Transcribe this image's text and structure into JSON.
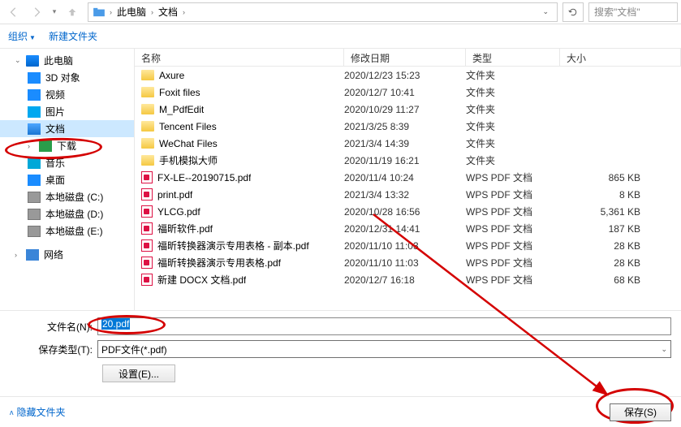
{
  "breadcrumb": {
    "root": "此电脑",
    "folder": "文档"
  },
  "search_placeholder": "搜索\"文档\"",
  "subtoolbar": {
    "organize": "组织",
    "newfolder": "新建文件夹"
  },
  "sidebar": {
    "this_pc": "此电脑",
    "items": [
      {
        "label": "3D 对象"
      },
      {
        "label": "视频"
      },
      {
        "label": "图片"
      },
      {
        "label": "文档"
      },
      {
        "label": "下载"
      },
      {
        "label": "音乐"
      },
      {
        "label": "桌面"
      },
      {
        "label": "本地磁盘 (C:)"
      },
      {
        "label": "本地磁盘 (D:)"
      },
      {
        "label": "本地磁盘 (E:)"
      }
    ],
    "network": "网络"
  },
  "columns": {
    "name": "名称",
    "date": "修改日期",
    "type": "类型",
    "size": "大小"
  },
  "files": [
    {
      "name": "Axure",
      "date": "2020/12/23 15:23",
      "type": "文件夹",
      "size": "",
      "icon": "folder"
    },
    {
      "name": "Foxit files",
      "date": "2020/12/7 10:41",
      "type": "文件夹",
      "size": "",
      "icon": "folder"
    },
    {
      "name": "M_PdfEdit",
      "date": "2020/10/29 11:27",
      "type": "文件夹",
      "size": "",
      "icon": "folder"
    },
    {
      "name": "Tencent Files",
      "date": "2021/3/25 8:39",
      "type": "文件夹",
      "size": "",
      "icon": "folder"
    },
    {
      "name": "WeChat Files",
      "date": "2021/3/4 14:39",
      "type": "文件夹",
      "size": "",
      "icon": "folder"
    },
    {
      "name": "手机模拟大师",
      "date": "2020/11/19 16:21",
      "type": "文件夹",
      "size": "",
      "icon": "folder"
    },
    {
      "name": "FX-LE--20190715.pdf",
      "date": "2020/11/4 10:24",
      "type": "WPS PDF 文档",
      "size": "865 KB",
      "icon": "pdf"
    },
    {
      "name": "print.pdf",
      "date": "2021/3/4 13:32",
      "type": "WPS PDF 文档",
      "size": "8 KB",
      "icon": "pdf"
    },
    {
      "name": "YLCG.pdf",
      "date": "2020/10/28 16:56",
      "type": "WPS PDF 文档",
      "size": "5,361 KB",
      "icon": "pdf"
    },
    {
      "name": "福昕软件.pdf",
      "date": "2020/12/31 14:41",
      "type": "WPS PDF 文档",
      "size": "187 KB",
      "icon": "pdf"
    },
    {
      "name": "福昕转换器演示专用表格 - 副本.pdf",
      "date": "2020/11/10 11:03",
      "type": "WPS PDF 文档",
      "size": "28 KB",
      "icon": "pdf"
    },
    {
      "name": "福昕转换器演示专用表格.pdf",
      "date": "2020/11/10 11:03",
      "type": "WPS PDF 文档",
      "size": "28 KB",
      "icon": "pdf"
    },
    {
      "name": "新建 DOCX 文档.pdf",
      "date": "2020/12/7 16:18",
      "type": "WPS PDF 文档",
      "size": "68 KB",
      "icon": "pdf"
    }
  ],
  "form": {
    "filename_label": "文件名(N):",
    "filename_value": "20.pdf",
    "filetype_label": "保存类型(T):",
    "filetype_value": "PDF文件(*.pdf)",
    "settings": "设置(E)..."
  },
  "footer": {
    "hide": "隐藏文件夹",
    "save": "保存(S)"
  }
}
